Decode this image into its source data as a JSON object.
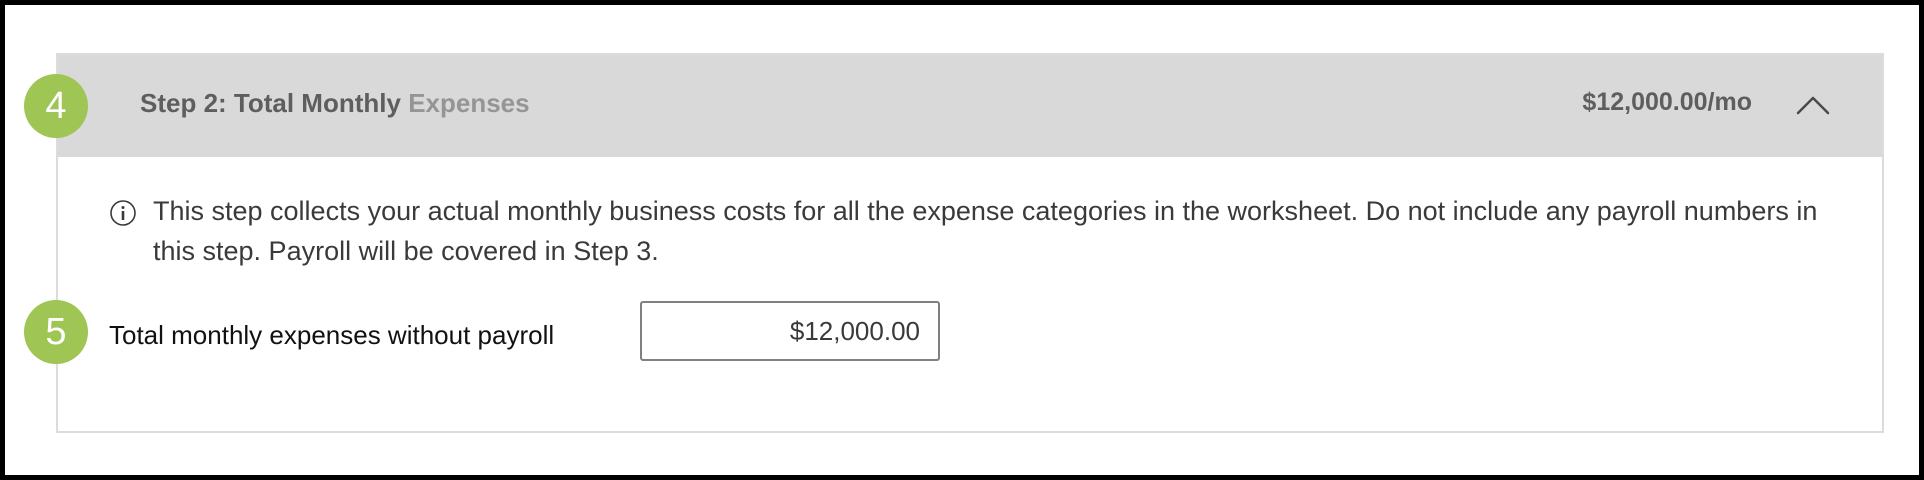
{
  "section": {
    "title_main": "Step 2: Total Monthly",
    "title_sub": "Expenses",
    "total": "$12,000.00/mo",
    "collapse_icon": "chevron-up-icon"
  },
  "info": {
    "icon": "info-icon",
    "text": "This step collects your actual monthly business costs for all the expense categories in the worksheet. Do not include any payroll numbers in this step. Payroll will be covered in Step 3."
  },
  "expenses_field": {
    "label": "Total monthly expenses without payroll",
    "value": "$12,000.00"
  },
  "annotations": [
    {
      "number": "4"
    },
    {
      "number": "5"
    }
  ],
  "colors": {
    "header_background": "#d9d9d9",
    "badge_green": "#9fc554",
    "title_text": "#5e5e5e",
    "title_muted": "#959595",
    "frame_border": "#000000"
  }
}
